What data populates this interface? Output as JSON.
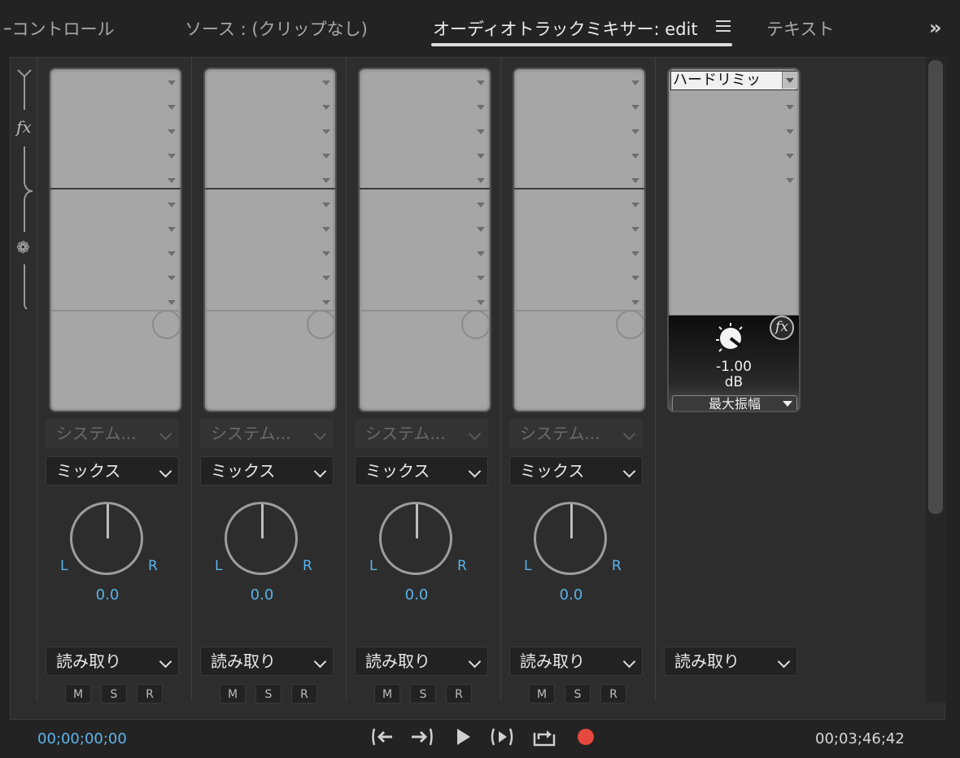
{
  "tabs": [
    {
      "label": "ｰコントロール",
      "active": false
    },
    {
      "label": "ソース : (クリップなし)",
      "active": false
    },
    {
      "label": "オーディオトラックミキサー: edit",
      "active": true
    },
    {
      "label": "テキスト",
      "active": false
    }
  ],
  "overflow_label": "»",
  "channels": [
    {
      "output": "システム...",
      "mode": "ミックス",
      "pan_l": "L",
      "pan_r": "R",
      "pan_value": "0.0",
      "automation": "読み取り",
      "m": "M",
      "s": "S",
      "r": "R"
    },
    {
      "output": "システム...",
      "mode": "ミックス",
      "pan_l": "L",
      "pan_r": "R",
      "pan_value": "0.0",
      "automation": "読み取り",
      "m": "M",
      "s": "S",
      "r": "R"
    },
    {
      "output": "システム...",
      "mode": "ミックス",
      "pan_l": "L",
      "pan_r": "R",
      "pan_value": "0.0",
      "automation": "読み取り",
      "m": "M",
      "s": "S",
      "r": "R"
    },
    {
      "output": "システム...",
      "mode": "ミックス",
      "pan_l": "L",
      "pan_r": "R",
      "pan_value": "0.0",
      "automation": "読み取り",
      "m": "M",
      "s": "S",
      "r": "R"
    }
  ],
  "master": {
    "effect_name": "ハードリミッ",
    "effect_value": "-1.00",
    "effect_unit": "dB",
    "effect_param": "最大振幅",
    "fx_label": "fx",
    "automation": "読み取り"
  },
  "legend": {
    "fx_label": "fx"
  },
  "transport": {
    "current_time": "00;00;00;00",
    "duration": "00;03;46;42",
    "buttons": [
      "go-to-in-point-icon",
      "go-to-out-point-icon",
      "play-icon",
      "play-in-to-out-icon",
      "loop-icon",
      "record-icon"
    ]
  },
  "colors": {
    "accent": "#59b3ea",
    "record": "#e5483e",
    "background": "#232323"
  }
}
